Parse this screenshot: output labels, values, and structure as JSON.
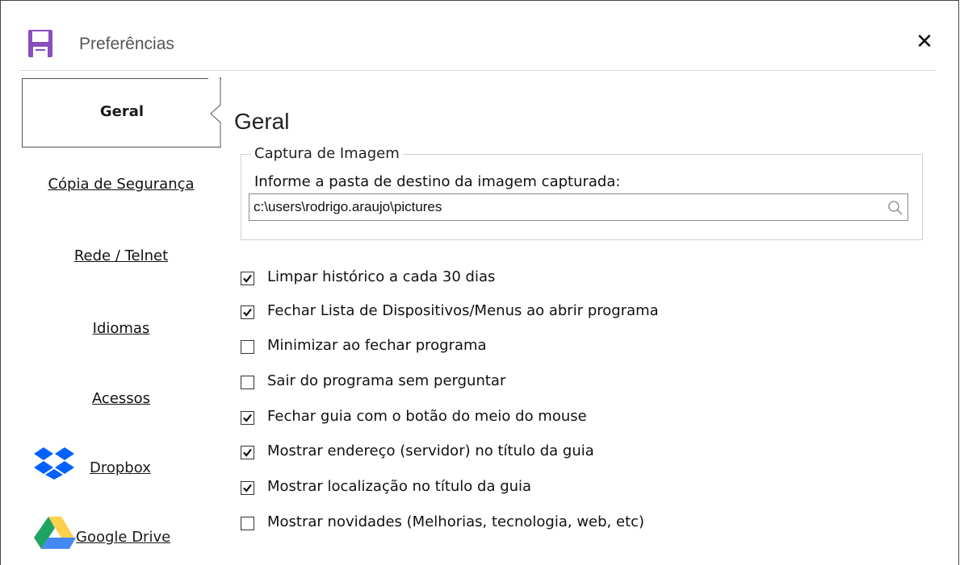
{
  "window": {
    "title": "Preferências",
    "close_symbol": "✕"
  },
  "sidebar": {
    "items": [
      {
        "label": "Geral",
        "active": true
      },
      {
        "label": "Cópia de Segurança"
      },
      {
        "label": "Rede / Telnet"
      },
      {
        "label": "Idiomas"
      },
      {
        "label": "Acessos"
      },
      {
        "label": "Dropbox",
        "icon": "dropbox-icon"
      },
      {
        "label": "Google Drive",
        "icon": "google-drive-icon"
      }
    ]
  },
  "main": {
    "section_title": "Geral",
    "capture": {
      "legend": "Captura de Imagem",
      "label": "Informe a pasta de destino da imagem capturada:",
      "path": "c:\\users\\rodrigo.araujo\\pictures"
    },
    "options": [
      {
        "label": "Limpar histórico a cada 30 dias",
        "checked": true
      },
      {
        "label": "Fechar Lista de Dispositivos/Menus ao abrir programa",
        "checked": true
      },
      {
        "label": "Minimizar ao fechar programa",
        "checked": false
      },
      {
        "label": "Sair do programa sem perguntar",
        "checked": false
      },
      {
        "label": "Fechar guia com o botão do meio do mouse",
        "checked": true
      },
      {
        "label": "Mostrar endereço (servidor) no título da guia",
        "checked": true
      },
      {
        "label": "Mostrar localização no título da guia",
        "checked": true
      },
      {
        "label": "Mostrar novidades (Melhorias, tecnologia, web, etc)",
        "checked": false
      }
    ]
  },
  "colors": {
    "app_icon": "#8a4fbf",
    "dropbox": "#0061fe",
    "gdrive_green": "#1fa463",
    "gdrive_yellow": "#ffd04b",
    "gdrive_blue": "#4688f4"
  }
}
